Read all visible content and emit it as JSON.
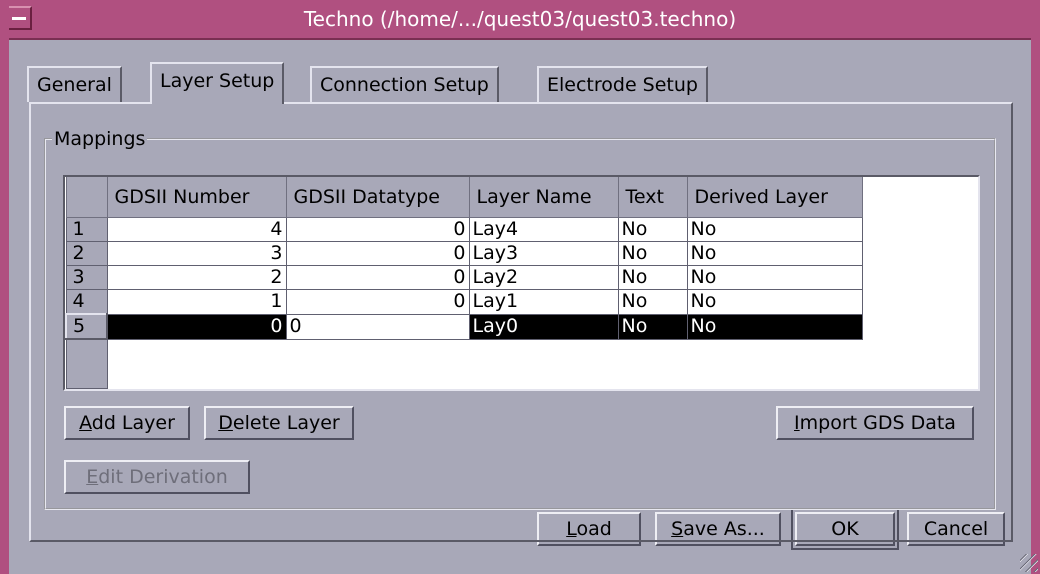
{
  "window": {
    "title": "Techno (/home/.../quest03/quest03.techno)"
  },
  "tabs": [
    {
      "label": "General"
    },
    {
      "label": "Layer Setup",
      "active": true
    },
    {
      "label": "Connection Setup"
    },
    {
      "label": "Electrode Setup"
    }
  ],
  "mappings": {
    "legend": "Mappings",
    "columns": [
      "GDSII Number",
      "GDSII Datatype",
      "Layer Name",
      "Text",
      "Derived Layer"
    ],
    "rows": [
      {
        "row": "1",
        "gds_number": "4",
        "gds_datatype": "0",
        "layer_name": "Lay4",
        "text": "No",
        "derived": "No"
      },
      {
        "row": "2",
        "gds_number": "3",
        "gds_datatype": "0",
        "layer_name": "Lay3",
        "text": "No",
        "derived": "No"
      },
      {
        "row": "3",
        "gds_number": "2",
        "gds_datatype": "0",
        "layer_name": "Lay2",
        "text": "No",
        "derived": "No"
      },
      {
        "row": "4",
        "gds_number": "1",
        "gds_datatype": "0",
        "layer_name": "Lay1",
        "text": "No",
        "derived": "No"
      },
      {
        "row": "5",
        "gds_number": "0",
        "gds_datatype": "0",
        "layer_name": "Lay0",
        "text": "No",
        "derived": "No",
        "selected": true,
        "editing_field": "gds_datatype"
      }
    ]
  },
  "buttons": {
    "add_layer": {
      "mnemonic": "A",
      "rest": "dd Layer"
    },
    "delete_layer": {
      "mnemonic": "D",
      "rest": "elete Layer"
    },
    "import_gds": {
      "mnemonic": "I",
      "rest": "mport GDS Data"
    },
    "edit_derivation": {
      "mnemonic": "E",
      "rest": "dit Derivation",
      "disabled": true
    },
    "load": {
      "mnemonic": "L",
      "rest": "oad"
    },
    "save_as": {
      "mnemonic": "S",
      "rest": "ave As..."
    },
    "ok": {
      "label": "OK"
    },
    "cancel": {
      "label": "Cancel"
    }
  },
  "colors": {
    "titlebar": "#b05080",
    "background": "#a8a8b8",
    "selection": "#000000"
  },
  "icons": [
    "window-menu-icon",
    "resize-grip-icon"
  ]
}
